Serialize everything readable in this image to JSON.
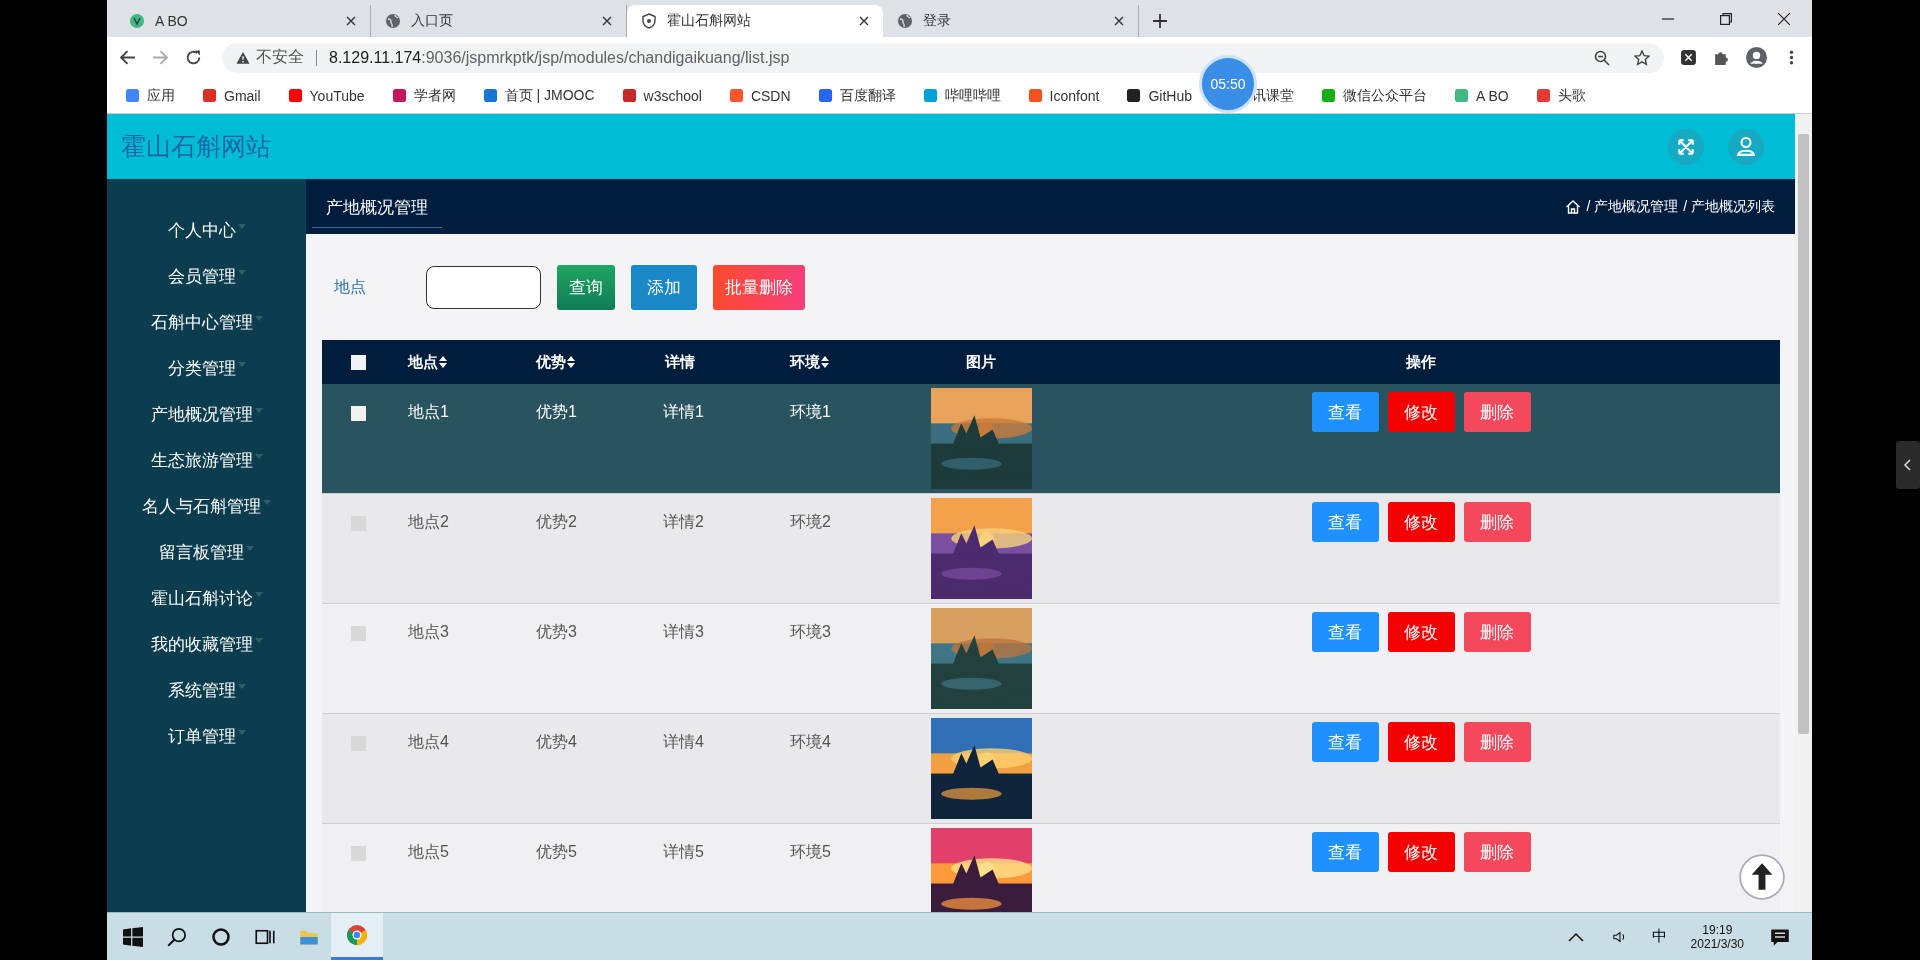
{
  "browser": {
    "tabs": [
      {
        "title": "A BO",
        "selected": false
      },
      {
        "title": "入口页",
        "selected": false
      },
      {
        "title": "霍山石斛网站",
        "selected": true
      },
      {
        "title": "登录",
        "selected": false
      }
    ],
    "address": {
      "security": "不安全",
      "host": "8.129.11.174",
      "path": ":9036/jspmrkptk/jsp/modules/chandigaikuang/list.jsp"
    },
    "bookmarks": [
      {
        "label": "应用",
        "color": "#4285f4"
      },
      {
        "label": "Gmail",
        "color": "#d93025"
      },
      {
        "label": "YouTube",
        "color": "#ff0000"
      },
      {
        "label": "学者网",
        "color": "#c2185b"
      },
      {
        "label": "首页 | JMOOC",
        "color": "#1976d2"
      },
      {
        "label": "w3school",
        "color": "#c62828"
      },
      {
        "label": "CSDN",
        "color": "#fc5531"
      },
      {
        "label": "百度翻译",
        "color": "#2468f2"
      },
      {
        "label": "哔哩哔哩",
        "color": "#00a1d6"
      },
      {
        "label": "Iconfont",
        "color": "#f4511e"
      },
      {
        "label": "GitHub",
        "color": "#222222"
      },
      {
        "label": "讯课堂"
      },
      {
        "label": "微信公众平台",
        "color": "#1aad19"
      },
      {
        "label": "A BO",
        "color": "#42b883"
      },
      {
        "label": "头歌",
        "color": "#e53935"
      }
    ],
    "timer": "05:50"
  },
  "site": {
    "title": "霍山石斛网站"
  },
  "sidebar": {
    "items": [
      "个人中心",
      "会员管理",
      "石斛中心管理",
      "分类管理",
      "产地概况管理",
      "生态旅游管理",
      "名人与石斛管理",
      "留言板管理",
      "霍山石斛讨论",
      "我的收藏管理",
      "系统管理",
      "订单管理"
    ]
  },
  "page": {
    "heading": "产地概况管理",
    "breadcrumb": [
      "/ 产地概况管理",
      "/ 产地概况列表"
    ]
  },
  "search": {
    "label": "地点",
    "buttons": [
      {
        "label": "查询",
        "kind": "search"
      },
      {
        "label": "添加",
        "kind": "add"
      },
      {
        "label": "批量删除",
        "kind": "delete"
      }
    ]
  },
  "table": {
    "all_checked": false,
    "columns": [
      {
        "label": "地点",
        "sortable": true
      },
      {
        "label": "优势",
        "sortable": true
      },
      {
        "label": "详情",
        "sortable": false
      },
      {
        "label": "环境",
        "sortable": true
      },
      {
        "label": "图片",
        "sortable": false
      },
      {
        "label": "操作",
        "sortable": false
      }
    ],
    "rows": [
      {
        "cells": [
          "地点1",
          "优势1",
          "详情1",
          "环境1"
        ],
        "checked": false,
        "highlighted": true,
        "actions": [
          {
            "label": "查看",
            "kind": "view"
          },
          {
            "label": "修改",
            "kind": "edit"
          },
          {
            "label": "删除",
            "kind": "delete"
          }
        ]
      },
      {
        "cells": [
          "地点2",
          "优势2",
          "详情2",
          "环境2"
        ],
        "checked": false,
        "highlighted": false,
        "actions": [
          {
            "label": "查看",
            "kind": "view"
          },
          {
            "label": "修改",
            "kind": "edit"
          },
          {
            "label": "删除",
            "kind": "delete"
          }
        ]
      },
      {
        "cells": [
          "地点3",
          "优势3",
          "详情3",
          "环境3"
        ],
        "checked": false,
        "highlighted": false,
        "actions": [
          {
            "label": "查看",
            "kind": "view"
          },
          {
            "label": "修改",
            "kind": "edit"
          },
          {
            "label": "删除",
            "kind": "delete"
          }
        ]
      },
      {
        "cells": [
          "地点4",
          "优势4",
          "详情4",
          "环境4"
        ],
        "checked": false,
        "highlighted": false,
        "actions": [
          {
            "label": "查看",
            "kind": "view"
          },
          {
            "label": "修改",
            "kind": "edit"
          },
          {
            "label": "删除",
            "kind": "delete"
          }
        ]
      },
      {
        "cells": [
          "地点5",
          "优势5",
          "详情5",
          "环境5"
        ],
        "checked": false,
        "highlighted": false,
        "actions": [
          {
            "label": "查看",
            "kind": "view"
          },
          {
            "label": "修改",
            "kind": "edit"
          },
          {
            "label": "删除",
            "kind": "delete"
          }
        ]
      }
    ]
  },
  "taskbar": {
    "ime": "中",
    "time": "19:19",
    "date": "2021/3/30"
  }
}
